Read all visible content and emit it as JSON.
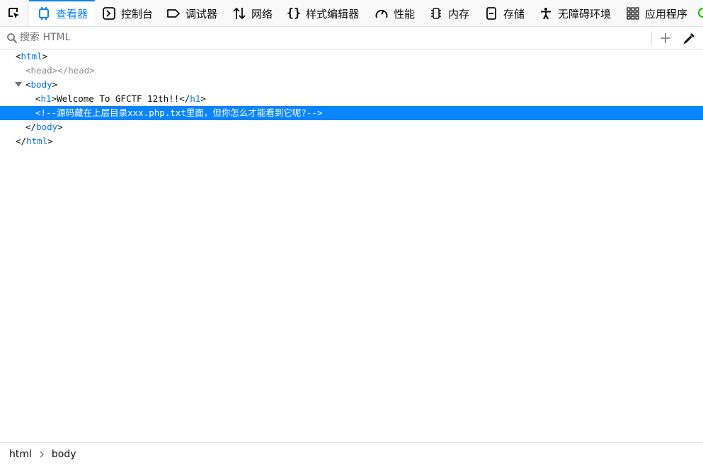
{
  "toolbar": {
    "tabs": [
      {
        "label": "查看器",
        "icon": "inspector-icon"
      },
      {
        "label": "控制台",
        "icon": "console-icon"
      },
      {
        "label": "调试器",
        "icon": "debugger-icon"
      },
      {
        "label": "网络",
        "icon": "network-icon"
      },
      {
        "label": "样式编辑器",
        "icon": "style-editor-icon"
      },
      {
        "label": "性能",
        "icon": "performance-icon"
      },
      {
        "label": "内存",
        "icon": "memory-icon"
      },
      {
        "label": "存储",
        "icon": "storage-icon"
      },
      {
        "label": "无障碍环境",
        "icon": "accessibility-icon"
      },
      {
        "label": "应用程序",
        "icon": "application-icon"
      }
    ],
    "active_tab": "查看器"
  },
  "search": {
    "placeholder": "搜索 HTML",
    "value": ""
  },
  "markup": {
    "html_tag": "html",
    "head_tag": "head",
    "body_tag": "body",
    "h1_tag": "h1",
    "h1_text": "Welcome To GFCTF 12th!!",
    "comment": "<!--源码藏在上层目录xxx.php.txt里面，但你怎么才能看到它呢?-->"
  },
  "breadcrumbs": {
    "items": [
      "html",
      "body"
    ]
  },
  "colors": {
    "accent": "#0a84ff",
    "tag_name": "#0074e8",
    "selection": "#0a84ff"
  }
}
